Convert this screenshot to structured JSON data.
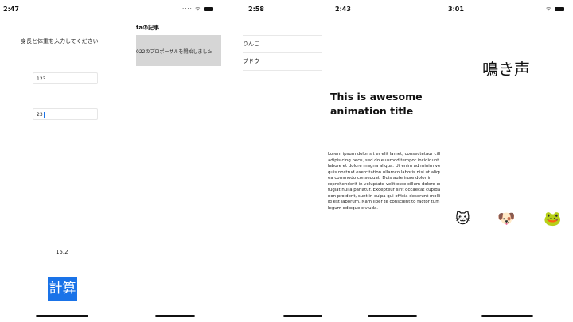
{
  "panels": {
    "bmi": {
      "time": "2:47",
      "prompt": "身長と体重を入力してください",
      "height_value": "123",
      "weight_value": "23",
      "result": "15.2",
      "calc_label": "計算"
    },
    "articles": {
      "nav_title": "taの記事",
      "article_snippet": "022のプロポーザルを開始しました"
    },
    "list": {
      "time": "2:58",
      "items": [
        "りんご",
        "ブドウ"
      ]
    },
    "animation": {
      "time": "2:43",
      "title": "This is awesome animation title",
      "body": "Lorem ipsum dolor sit er elit lamet, consectetaur cillium adipisicing pecu, sed do eiusmod tempor incididunt ut labore et dolore magna aliqua. Ut enim ad minim veniam, quis nostrud exercitation ullamco laboris nisi ut aliquip ex ea commodo consequat. Duis aute irure dolor in reprehenderit in voluptate velit esse cillum dolore eu fugiat nulla pariatur. Excepteur sint occaecat cupidatat non proident, sunt in culpa qui officia deserunt mollit anim id est laborum. Nam liber te conscient to factor tum poen legum odioque civiuda."
    },
    "sounds": {
      "time": "3:01",
      "heading": "鳴き声",
      "animals": {
        "cat": "🐱",
        "dog": "🐶",
        "frog": "🐸"
      }
    }
  },
  "status_icons": "····  ᯤ",
  "icons": [
    "wifi-icon",
    "battery-icon",
    "home-indicator"
  ],
  "colors": {
    "accent": "#1a73e8",
    "article_bg": "#d6d6d6"
  }
}
